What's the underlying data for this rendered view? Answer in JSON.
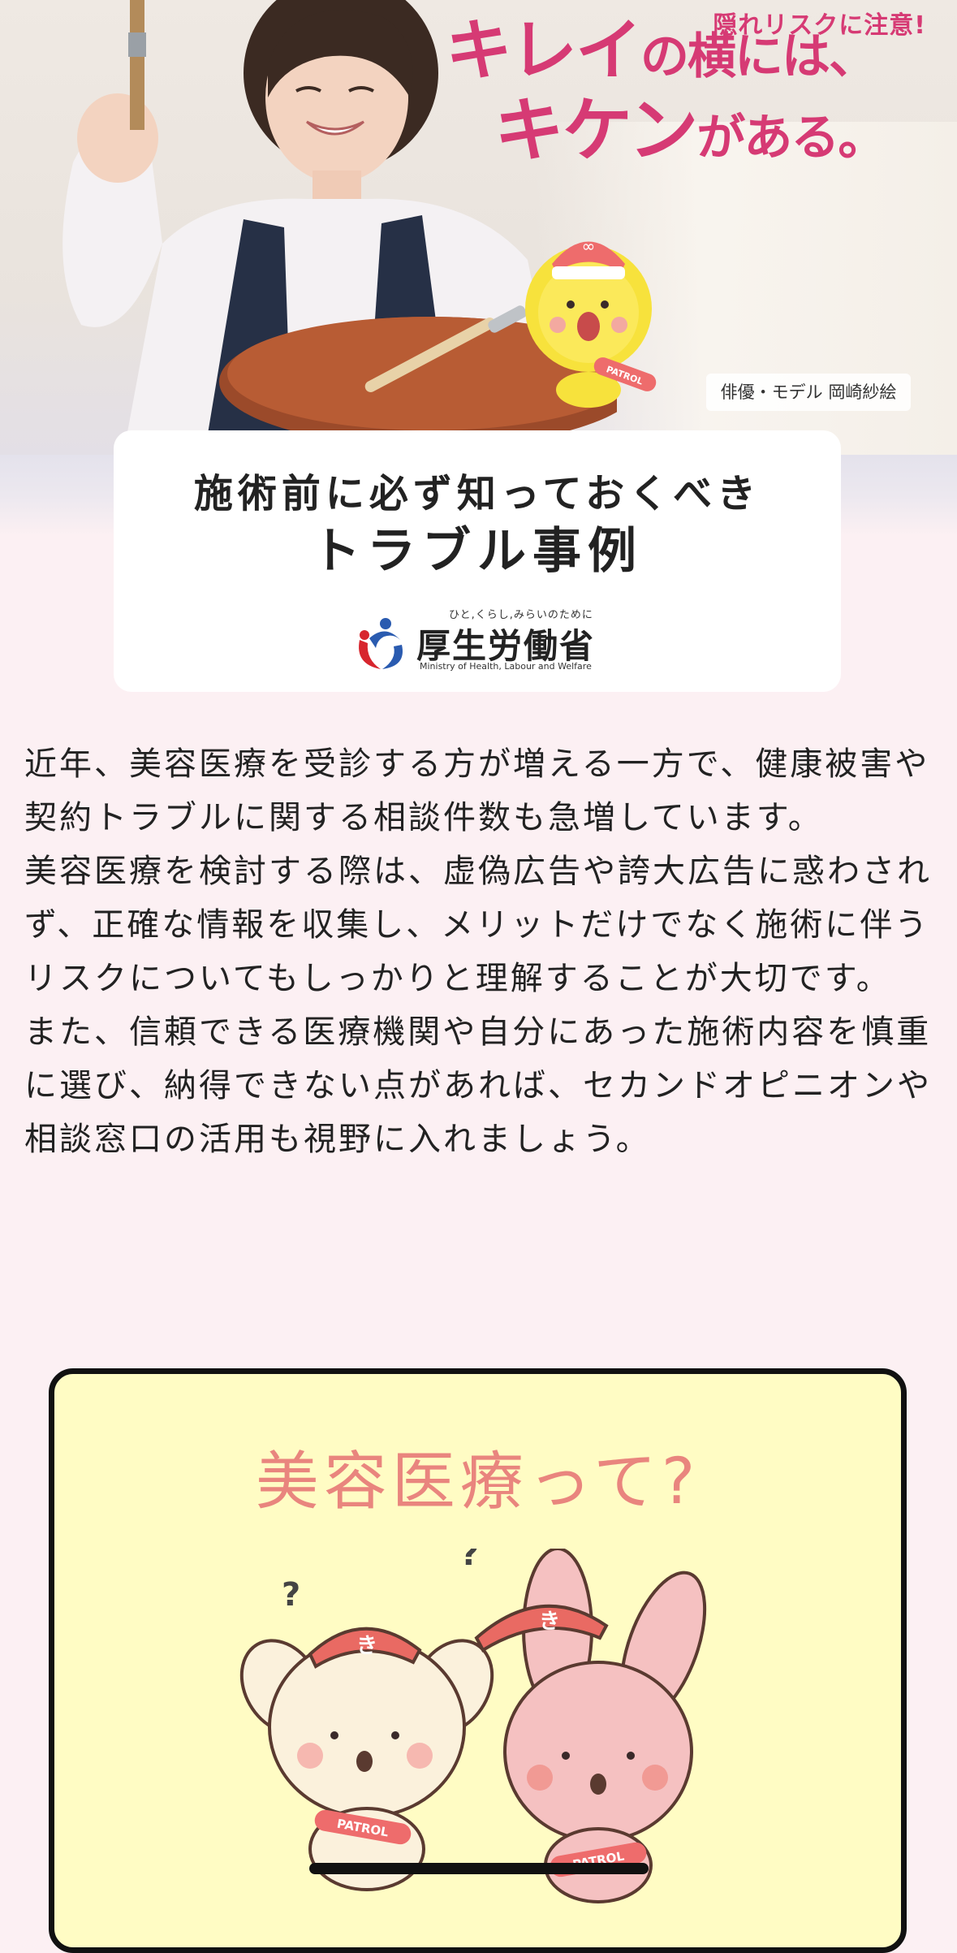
{
  "hero": {
    "headline_small": "隠れリスクに注意!",
    "headline_line1_big": "キレイ",
    "headline_line1_small": "の横には、",
    "headline_line2_big": "キケン",
    "headline_line2_small": "がある。",
    "credit": "俳優・モデル 岡崎紗絵",
    "badge_text": "PATROL"
  },
  "title_card": {
    "subtitle": "施術前に必ず知っておくべき",
    "title": "トラブル事例",
    "ministry_tagline": "ひと,くらし,みらいのために",
    "ministry_name": "厚生労働省",
    "ministry_english": "Ministry of Health, Labour and Welfare"
  },
  "intro": {
    "p1": "近年、美容医療を受診する方が増える一方で、健康被害や契約トラブルに関する相談件数も急増しています。",
    "p2": "美容医療を検討する際は、虚偽広告や誇大広告に惑わされず、正確な情報を収集し、メリットだけでなく施術に伴うリスクについてもしっかりと理解することが大切です。",
    "p3": "また、信頼できる医療機関や自分にあった施術内容を慎重に選び、納得できない点があれば、セカンドオピニオンや相談窓口の活用も視野に入れましょう。"
  },
  "question_card": {
    "title": "美容医療って?",
    "cap_letter": "き",
    "badge_text": "PATROL",
    "question_mark": "?"
  },
  "colors": {
    "accent_pink": "#d63a74",
    "page_bg": "#fcf0f3",
    "card_yellow": "#fffcc4",
    "title_salmon": "#e9857e"
  }
}
